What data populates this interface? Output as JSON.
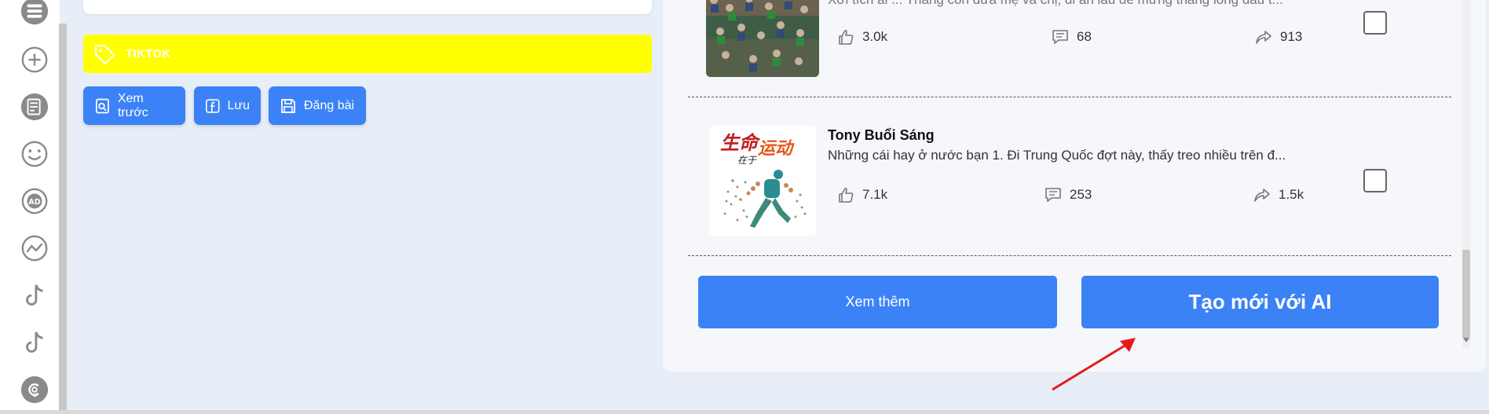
{
  "sidebar": {
    "icons": [
      "list-icon",
      "plus-circle-icon",
      "document-icon",
      "smile-icon",
      "ad-icon",
      "trend-icon",
      "tiktok-icon",
      "tiktok-icon",
      "threads-icon"
    ]
  },
  "left": {
    "tag_label": "TIKTOK",
    "buttons": {
      "preview": "Xem trước",
      "save": "Lưu",
      "post": "Đăng bài"
    }
  },
  "posts": [
    {
      "title": "",
      "text": "Xơi tích ai ... Thắng con đưa mẹ và chị, đi ăn lẩu để mừng thằng long dầu t...",
      "likes": "3.0k",
      "comments": "68",
      "shares": "913"
    },
    {
      "title": "Tony Buổi Sáng",
      "text": "Những cái hay ở nước bạn 1. Đi Trung Quốc đợt này, thấy treo nhiều trên đ...",
      "likes": "7.1k",
      "comments": "253",
      "shares": "1.5k",
      "thumb_caption": "生命在于运动"
    }
  ],
  "actions": {
    "see_more": "Xem thêm",
    "create_ai": "Tạo mới với AI"
  },
  "colors": {
    "primary": "#3b82f6",
    "tag": "#ffff00",
    "annotation": "#e8191c"
  }
}
